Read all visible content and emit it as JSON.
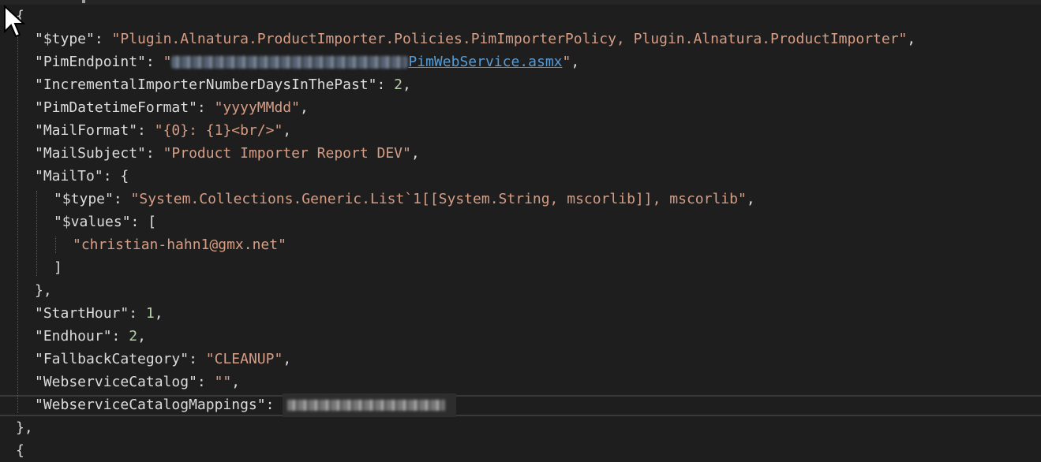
{
  "editor": {
    "lines": [
      {
        "indent": 0,
        "parts": [
          {
            "t": "p",
            "v": "{"
          }
        ]
      },
      {
        "indent": 1,
        "parts": [
          {
            "t": "k",
            "v": "\"$type\""
          },
          {
            "t": "p",
            "v": ": "
          },
          {
            "t": "s",
            "v": "\"Plugin.Alnatura.ProductImporter.Policies.PimImporterPolicy, Plugin.Alnatura.ProductImporter\""
          },
          {
            "t": "p",
            "v": ","
          }
        ]
      },
      {
        "indent": 1,
        "parts": [
          {
            "t": "k",
            "v": "\"PimEndpoint\""
          },
          {
            "t": "p",
            "v": ": "
          },
          {
            "t": "s",
            "v": "\""
          },
          {
            "t": "blurl",
            "v": ""
          },
          {
            "t": "link",
            "v": "PimWebService.asmx"
          },
          {
            "t": "s",
            "v": "\""
          },
          {
            "t": "p",
            "v": ","
          }
        ]
      },
      {
        "indent": 1,
        "parts": [
          {
            "t": "k",
            "v": "\"IncrementalImporterNumberDaysInThePast\""
          },
          {
            "t": "p",
            "v": ": "
          },
          {
            "t": "n",
            "v": "2"
          },
          {
            "t": "p",
            "v": ","
          }
        ]
      },
      {
        "indent": 1,
        "parts": [
          {
            "t": "k",
            "v": "\"PimDatetimeFormat\""
          },
          {
            "t": "p",
            "v": ": "
          },
          {
            "t": "s",
            "v": "\"yyyyMMdd\""
          },
          {
            "t": "p",
            "v": ","
          }
        ]
      },
      {
        "indent": 1,
        "parts": [
          {
            "t": "k",
            "v": "\"MailFormat\""
          },
          {
            "t": "p",
            "v": ": "
          },
          {
            "t": "s",
            "v": "\"{0}: {1}<br/>\""
          },
          {
            "t": "p",
            "v": ","
          }
        ]
      },
      {
        "indent": 1,
        "parts": [
          {
            "t": "k",
            "v": "\"MailSubject\""
          },
          {
            "t": "p",
            "v": ": "
          },
          {
            "t": "s",
            "v": "\"Product Importer Report DEV\""
          },
          {
            "t": "p",
            "v": ","
          }
        ]
      },
      {
        "indent": 1,
        "parts": [
          {
            "t": "k",
            "v": "\"MailTo\""
          },
          {
            "t": "p",
            "v": ": {"
          }
        ]
      },
      {
        "indent": 2,
        "parts": [
          {
            "t": "k",
            "v": "\"$type\""
          },
          {
            "t": "p",
            "v": ": "
          },
          {
            "t": "s",
            "v": "\"System.Collections.Generic.List`1[[System.String, mscorlib]], mscorlib\""
          },
          {
            "t": "p",
            "v": ","
          }
        ]
      },
      {
        "indent": 2,
        "parts": [
          {
            "t": "k",
            "v": "\"$values\""
          },
          {
            "t": "p",
            "v": ": ["
          }
        ]
      },
      {
        "indent": 3,
        "parts": [
          {
            "t": "s",
            "v": "\"christian-hahn1@gmx.net\""
          }
        ]
      },
      {
        "indent": 2,
        "parts": [
          {
            "t": "p",
            "v": "]"
          }
        ]
      },
      {
        "indent": 1,
        "parts": [
          {
            "t": "p",
            "v": "},"
          }
        ]
      },
      {
        "indent": 1,
        "parts": [
          {
            "t": "k",
            "v": "\"StartHour\""
          },
          {
            "t": "p",
            "v": ": "
          },
          {
            "t": "n",
            "v": "1"
          },
          {
            "t": "p",
            "v": ","
          }
        ]
      },
      {
        "indent": 1,
        "parts": [
          {
            "t": "k",
            "v": "\"Endhour\""
          },
          {
            "t": "p",
            "v": ": "
          },
          {
            "t": "n",
            "v": "2"
          },
          {
            "t": "p",
            "v": ","
          }
        ]
      },
      {
        "indent": 1,
        "parts": [
          {
            "t": "k",
            "v": "\"FallbackCategory\""
          },
          {
            "t": "p",
            "v": ": "
          },
          {
            "t": "s",
            "v": "\"CLEANUP\""
          },
          {
            "t": "p",
            "v": ","
          }
        ]
      },
      {
        "indent": 1,
        "parts": [
          {
            "t": "k",
            "v": "\"WebserviceCatalog\""
          },
          {
            "t": "p",
            "v": ": "
          },
          {
            "t": "s",
            "v": "\"\""
          },
          {
            "t": "p",
            "v": ","
          }
        ]
      },
      {
        "indent": 1,
        "parts": [
          {
            "t": "k",
            "v": "\"WebserviceCatalogMappings\""
          },
          {
            "t": "p",
            "v": ": "
          },
          {
            "t": "blurv",
            "v": ""
          }
        ]
      },
      {
        "indent": 0,
        "parts": [
          {
            "t": "p",
            "v": "},"
          }
        ]
      },
      {
        "indent": 0,
        "parts": [
          {
            "t": "p",
            "v": "{"
          }
        ]
      }
    ]
  },
  "colors": {
    "background": "#1e1e1e",
    "key": "#dcdcdc",
    "string": "#d69d85",
    "number": "#b5cea8",
    "link": "#569cd6"
  },
  "icons": {
    "cursor": "mouse-pointer-icon"
  }
}
